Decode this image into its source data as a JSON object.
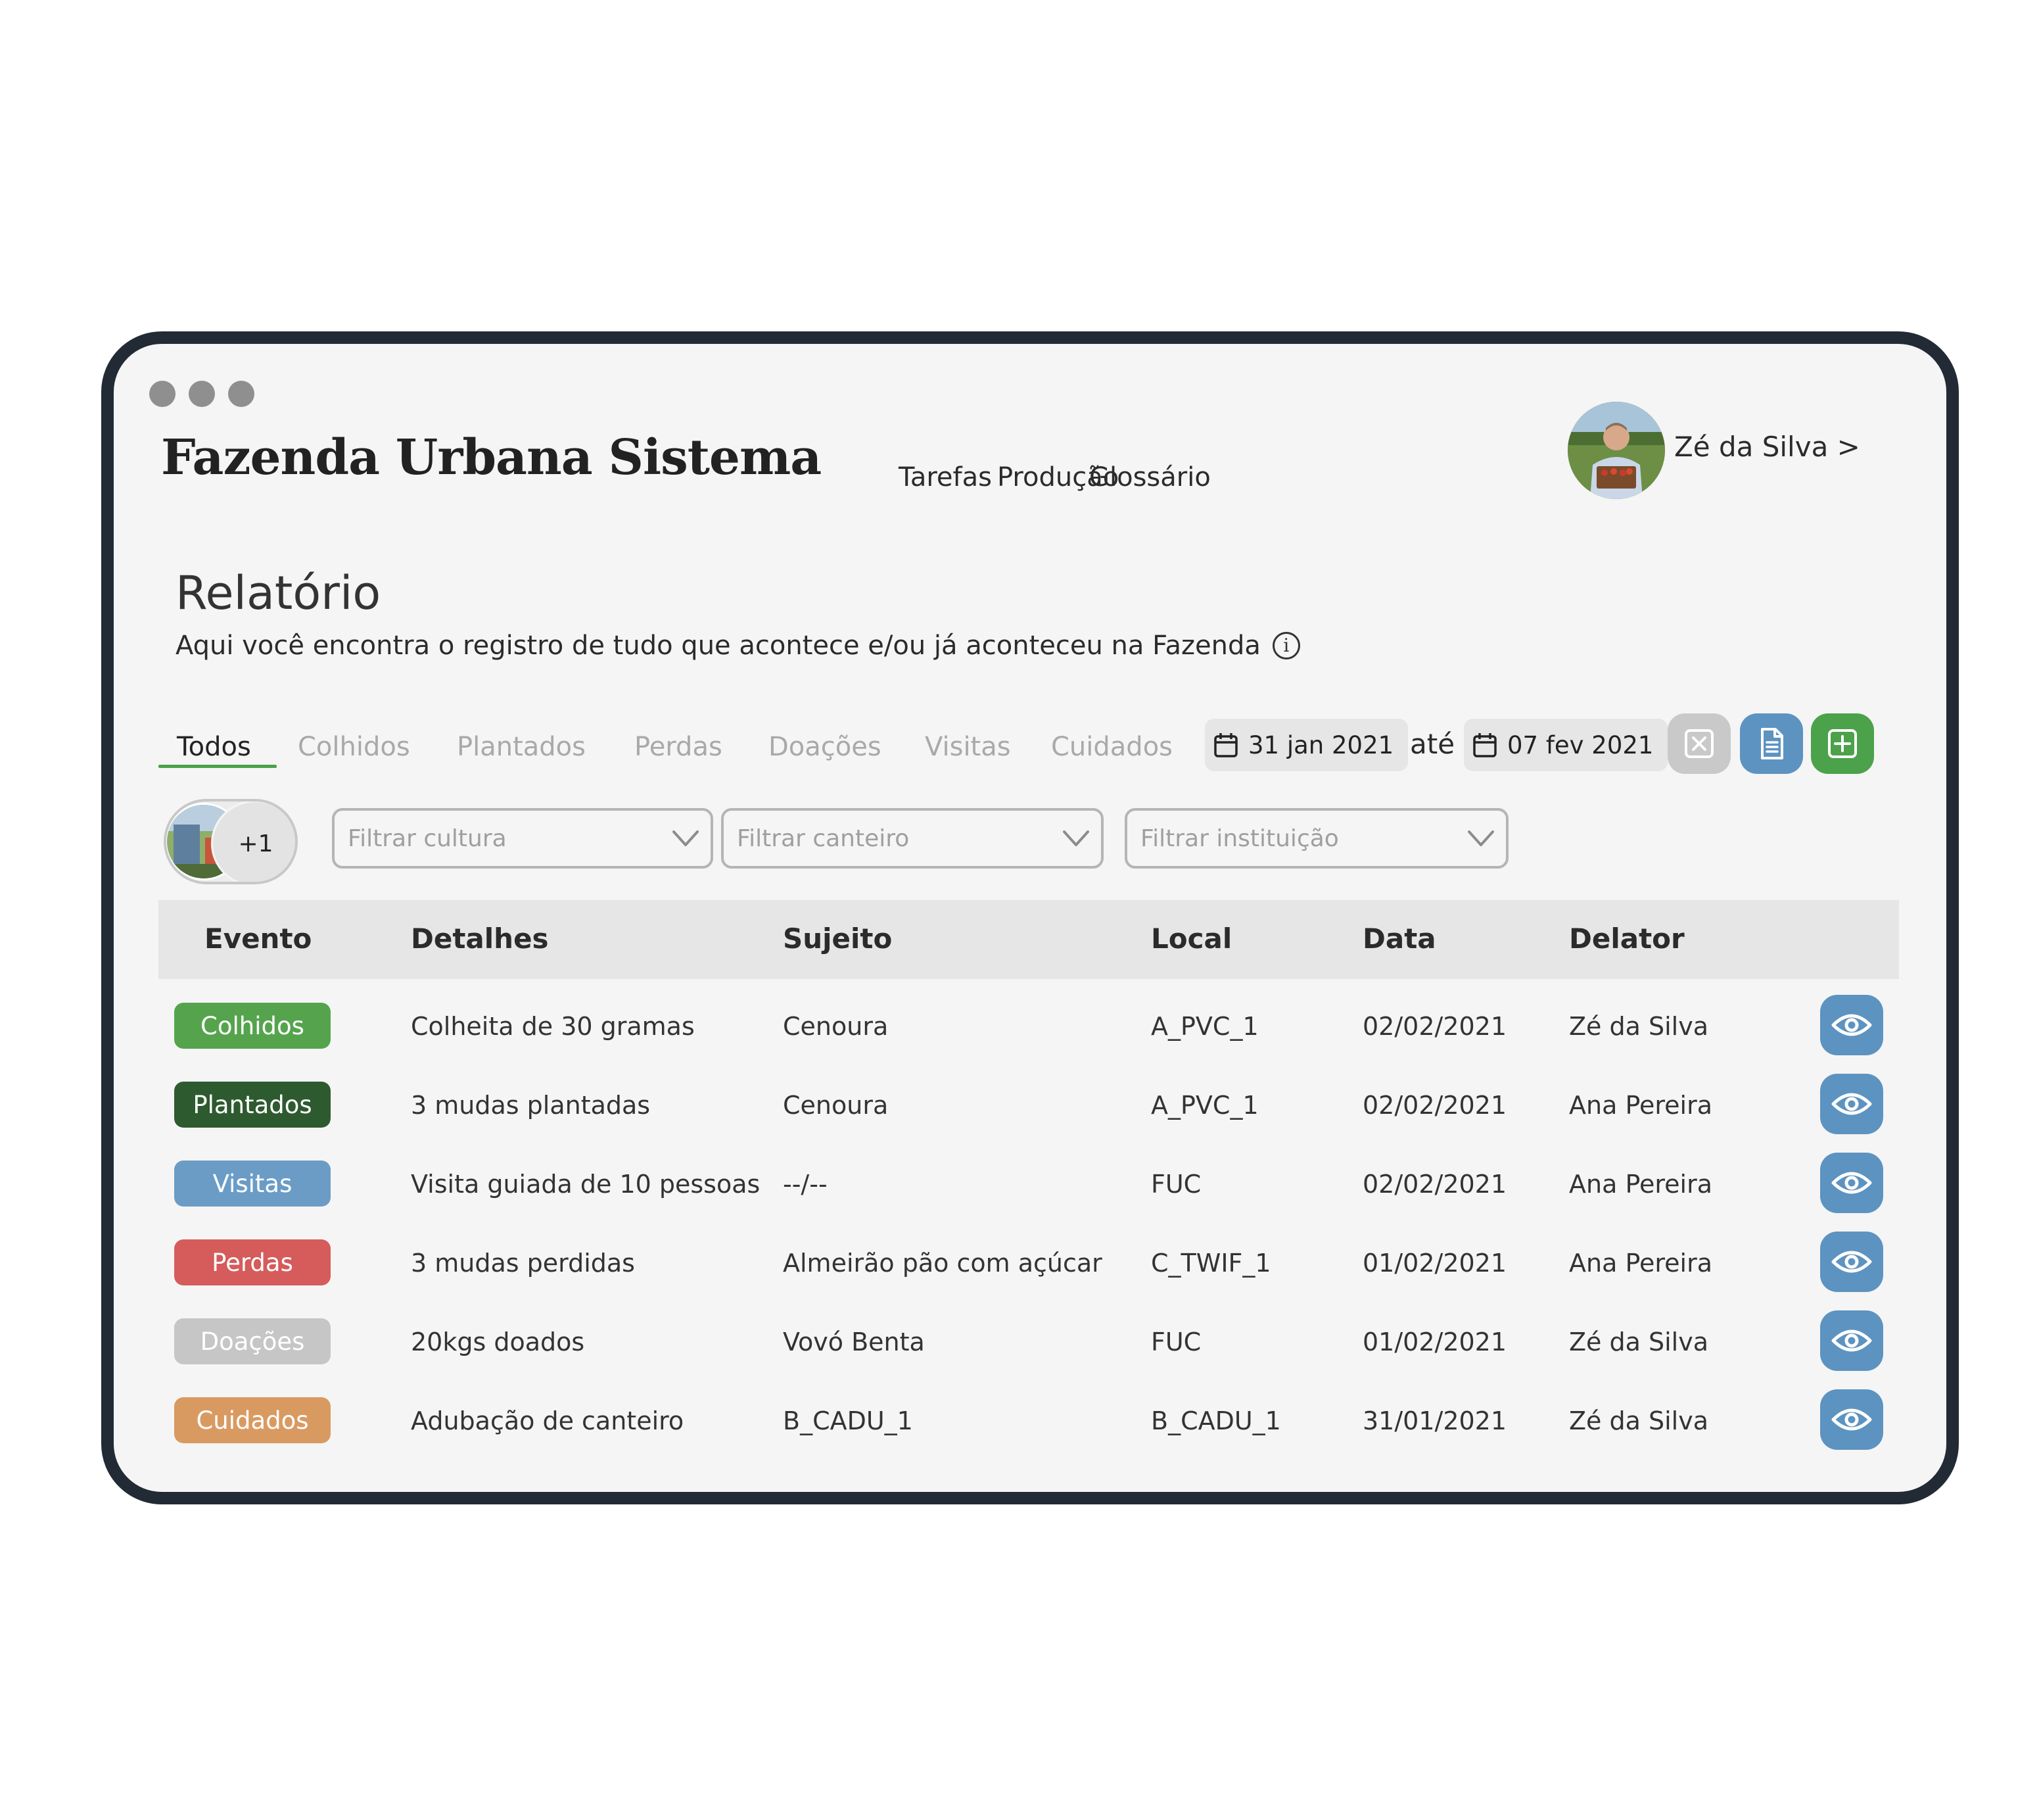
{
  "app": {
    "title": "Fazenda Urbana Sistema"
  },
  "nav": [
    "Tarefas",
    "Produção",
    "Glossário"
  ],
  "user": {
    "name": "Zé da Silva >"
  },
  "page": {
    "title": "Relatório",
    "subtitle": "Aqui você encontra o registro de tudo que acontece e/ou já aconteceu na Fazenda",
    "info_icon": "i"
  },
  "tabs": [
    "Todos",
    "Colhidos",
    "Plantados",
    "Perdas",
    "Doações",
    "Visitas",
    "Cuidados"
  ],
  "active_tab": "Todos",
  "date_range": {
    "start": "31 jan 2021",
    "separator": "até",
    "end": "07 fev 2021"
  },
  "actions": {
    "clear_icon": "close-square-icon",
    "export_icon": "document-icon",
    "add_icon": "plus-square-icon"
  },
  "photos": {
    "extra_count": "+1"
  },
  "filters": {
    "culture_placeholder": "Filtrar cultura",
    "bed_placeholder": "Filtrar canteiro",
    "institution_placeholder": "Filtrar instituição"
  },
  "table": {
    "headers": [
      "Evento",
      "Detalhes",
      "Sujeito",
      "Local",
      "Data",
      "Delator"
    ],
    "rows": [
      {
        "event": "Colhidos",
        "details": "Colheita de 30 gramas",
        "subject": "Cenoura",
        "location": "A_PVC_1",
        "date": "02/02/2021",
        "reporter": "Zé da Silva"
      },
      {
        "event": "Plantados",
        "details": "3 mudas plantadas",
        "subject": "Cenoura",
        "location": "A_PVC_1",
        "date": "02/02/2021",
        "reporter": "Ana Pereira"
      },
      {
        "event": "Visitas",
        "details": "Visita guiada de 10 pessoas",
        "subject": "--/--",
        "location": "FUC",
        "date": "02/02/2021",
        "reporter": "Ana Pereira"
      },
      {
        "event": "Perdas",
        "details": "3 mudas perdidas",
        "subject": "Almeirão pão com açúcar",
        "location": "C_TWIF_1",
        "date": "01/02/2021",
        "reporter": "Ana Pereira"
      },
      {
        "event": "Doações",
        "details": "20kgs doados",
        "subject": "Vovó Benta",
        "location": "FUC",
        "date": "01/02/2021",
        "reporter": "Zé da Silva"
      },
      {
        "event": "Cuidados",
        "details": "Adubação de canteiro",
        "subject": "B_CADU_1",
        "location": "B_CADU_1",
        "date": "31/01/2021",
        "reporter": "Zé da Silva"
      }
    ]
  },
  "colors": {
    "frame": "#222a35",
    "accent_green": "#4ba24a",
    "colhidos": "#55a44d",
    "plantados": "#2e5a2f",
    "visitas": "#6a9cc6",
    "perdas": "#d65b5b",
    "doacoes": "#c6c6c6",
    "cuidados": "#d99a62",
    "blue_button": "#5d93c0",
    "grey_button": "#c9c9c9"
  }
}
